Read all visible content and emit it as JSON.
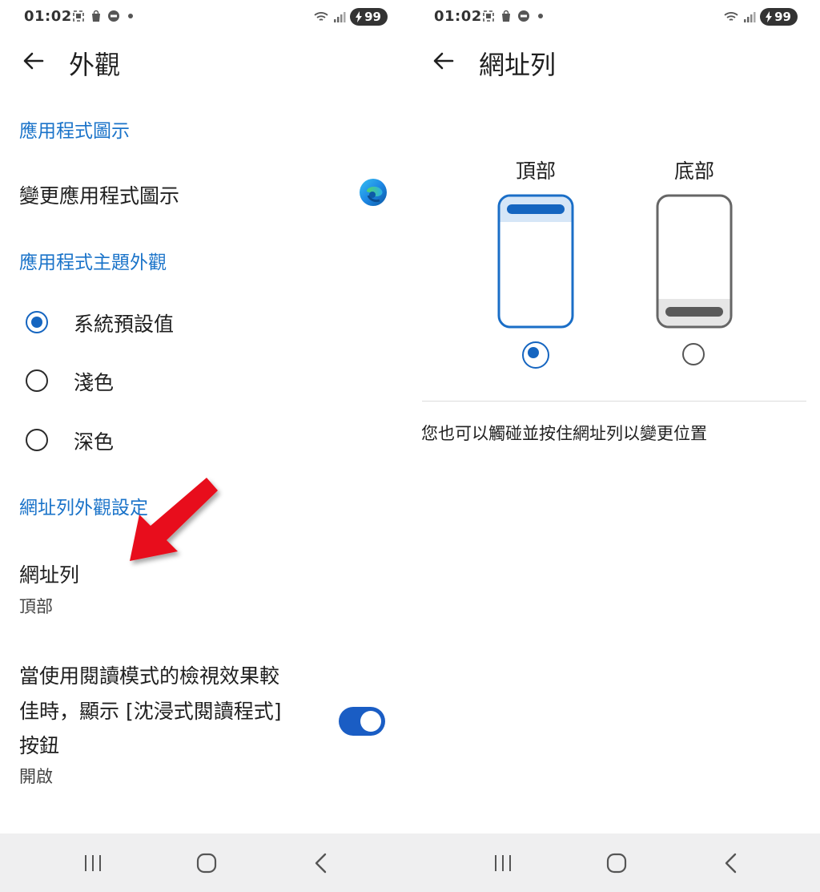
{
  "status_bar": {
    "time": "01:02",
    "battery": "99"
  },
  "left": {
    "title": "外觀",
    "sections": {
      "app_icon": "應用程式圖示",
      "app_theme": "應用程式主題外觀",
      "address_bar_settings": "網址列外觀設定"
    },
    "change_icon_label": "變更應用程式圖示",
    "theme_options": [
      {
        "label": "系統預設值",
        "selected": true
      },
      {
        "label": "淺色",
        "selected": false
      },
      {
        "label": "深色",
        "selected": false
      }
    ],
    "address_bar": {
      "title": "網址列",
      "value": "頂部"
    },
    "immersive_reader": {
      "line1": "當使用閱讀模式的檢視效果較",
      "line2": "佳時，顯示 [沈浸式閱讀程式]",
      "line3": "按鈕",
      "value": "開啟",
      "enabled": true
    }
  },
  "right": {
    "title": "網址列",
    "options": [
      {
        "label": "頂部",
        "selected": true
      },
      {
        "label": "底部",
        "selected": false
      }
    ],
    "hint": "您也可以觸碰並按住網址列以變更位置"
  },
  "colors": {
    "accent": "#1565c0",
    "section_header": "#1a73c9",
    "arrow": "#e8101a",
    "nav_bg": "#efeff0"
  },
  "icons": [
    "back-arrow-icon",
    "edge-logo-icon",
    "recent-apps-icon",
    "home-icon",
    "nav-back-icon"
  ]
}
